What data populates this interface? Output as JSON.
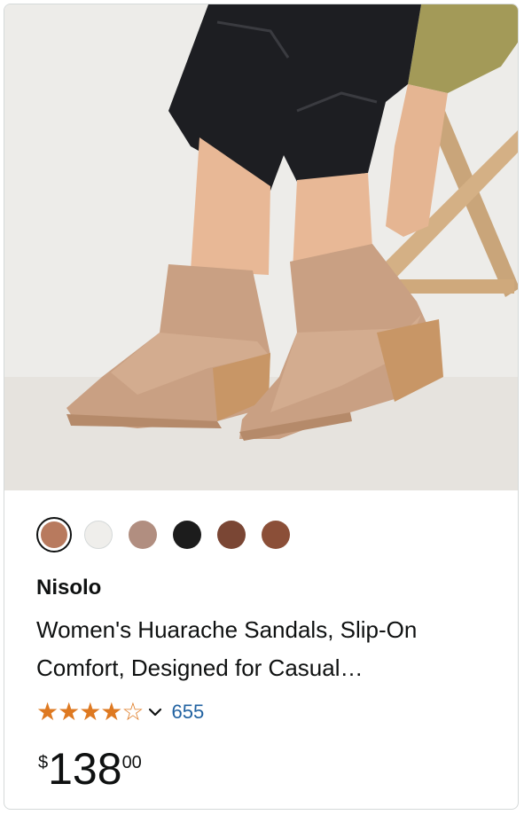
{
  "product": {
    "brand": "Nisolo",
    "title_line1": "Women's Huarache Sandals, Slip-On",
    "title_line2": "Comfort, Designed for Casual…",
    "rating_stars": "★★★★☆",
    "rating_value": 4.5,
    "review_count": "655",
    "price_symbol": "$",
    "price_whole": "138",
    "price_fraction": "00"
  },
  "swatches": [
    {
      "color": "#b87a5e",
      "selected": true
    },
    {
      "color": "#efeeeb",
      "selected": false
    },
    {
      "color": "#b18e80",
      "selected": false
    },
    {
      "color": "#1c1c1c",
      "selected": false
    },
    {
      "color": "#7a4634",
      "selected": false
    },
    {
      "color": "#8b4f38",
      "selected": false
    }
  ],
  "colors": {
    "star": "#de7921",
    "link": "#2162a1",
    "text": "#0f1111"
  }
}
